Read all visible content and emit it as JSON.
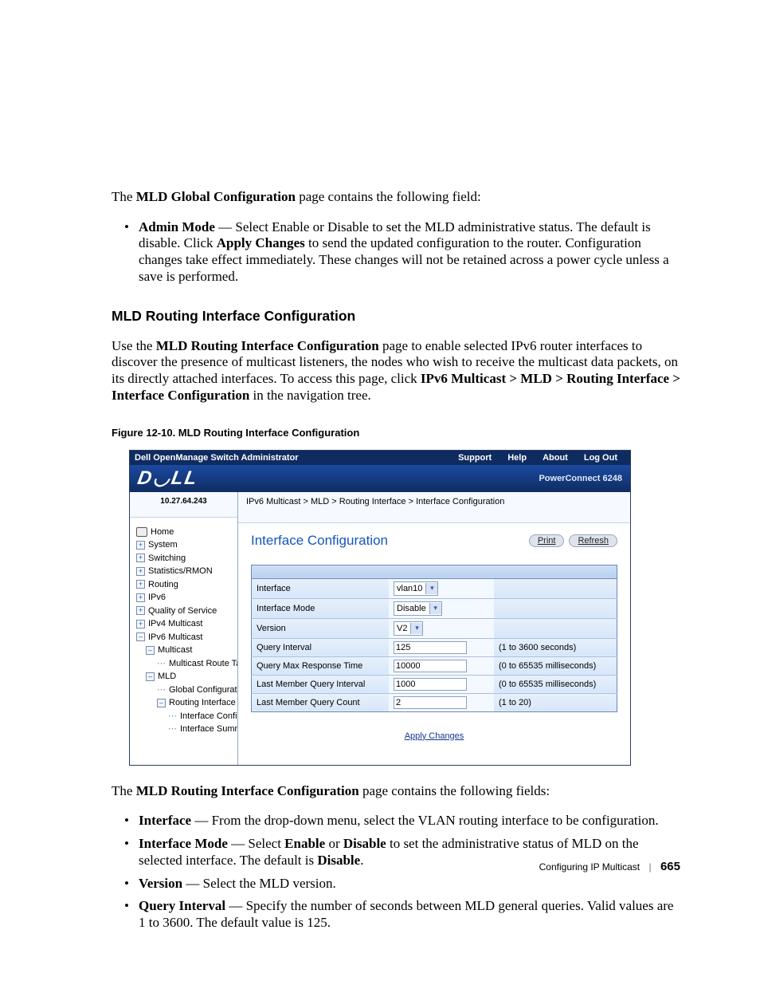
{
  "intro_para": {
    "pre": "The ",
    "boldname": "MLD Global Configuration",
    "post": " page contains the following field:"
  },
  "intro_bullet": {
    "b1": "Admin Mode",
    "t1": " — Select Enable or Disable to set the MLD administrative status. The default is disable. Click ",
    "b2": "Apply Changes",
    "t2": " to send the updated configuration to the router. Configuration changes take effect immediately. These changes will not be retained across a power cycle unless a save is performed."
  },
  "h2": "MLD Routing Interface Configuration",
  "desc": {
    "pre": "Use the ",
    "b1": "MLD Routing Interface Configuration",
    "mid": " page to enable selected IPv6 router interfaces to discover the presence of multicast listeners, the nodes who wish to receive the multicast data packets, on its directly attached interfaces. To access this page, click ",
    "b2": "IPv6 Multicast > MLD > Routing Interface > Interface Configuration",
    "post": " in the navigation tree."
  },
  "figcap": "Figure 12-10.    MLD Routing Interface Configuration",
  "shot": {
    "title": "Dell OpenManage Switch Administrator",
    "topbtns": [
      "Support",
      "Help",
      "About",
      "Log Out"
    ],
    "model": "PowerConnect 6248",
    "ip": "10.27.64.243",
    "crumbs": "IPv6 Multicast > MLD > Routing Interface > Interface Configuration",
    "h3": "Interface Configuration",
    "btn_print": "Print",
    "btn_refresh": "Refresh",
    "tree": {
      "home": "Home",
      "items_top": [
        "System",
        "Switching",
        "Statistics/RMON",
        "Routing",
        "IPv6",
        "Quality of Service",
        "IPv4 Multicast"
      ],
      "ipv6m": "IPv6 Multicast",
      "multicast": "Multicast",
      "mrt": "Multicast Route Tab",
      "mld": "MLD",
      "gc": "Global Configuration",
      "ri": "Routing Interface",
      "ric": "Interface Configur",
      "ris": "Interface Summa"
    },
    "rows": [
      {
        "label": "Interface",
        "sel": "vlan10",
        "hint": ""
      },
      {
        "label": "Interface Mode",
        "sel": "Disable",
        "hint": ""
      },
      {
        "label": "Version",
        "sel": "V2",
        "hint": ""
      },
      {
        "label": "Query Interval",
        "val": "125",
        "hint": "(1 to 3600 seconds)"
      },
      {
        "label": "Query Max Response Time",
        "val": "10000",
        "hint": "(0 to 65535 milliseconds)"
      },
      {
        "label": "Last Member Query Interval",
        "val": "1000",
        "hint": "(0 to 65535 milliseconds)"
      },
      {
        "label": "Last Member Query Count",
        "val": "2",
        "hint": "(1 to 20)"
      }
    ],
    "apply": "Apply Changes"
  },
  "after_para": {
    "pre": "The ",
    "b": "MLD Routing Interface Configuration",
    "post": " page contains the following fields:"
  },
  "bullets2": [
    {
      "b": "Interface",
      "t": " — From the drop-down menu, select the VLAN routing interface to be configuration."
    },
    {
      "b": "Interface Mode",
      "t": " — Select ",
      "b2": "Enable",
      "t2": " or ",
      "b3": "Disable",
      "t3": " to set the administrative status of MLD on the selected interface. The default is ",
      "b4": "Disable",
      "t4": "."
    },
    {
      "b": "Version",
      "t": " — Select the MLD version."
    },
    {
      "b": "Query Interval",
      "t": " — Specify the number of seconds between MLD general queries. Valid values are 1 to 3600. The default value is 125."
    }
  ],
  "footer": {
    "section": "Configuring IP Multicast",
    "page": "665"
  }
}
